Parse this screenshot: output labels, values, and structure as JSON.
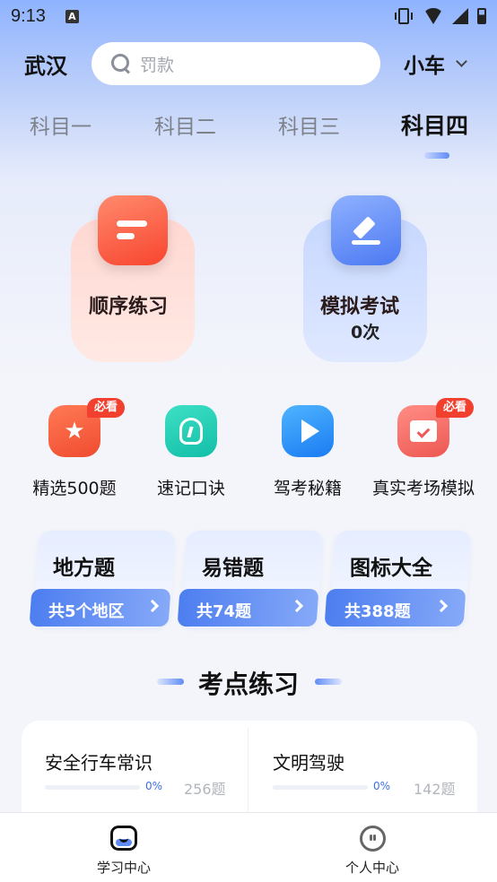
{
  "status_bar": {
    "time": "9:13",
    "notification_glyph": "A"
  },
  "header": {
    "city": "武汉",
    "search_placeholder": "罚款",
    "vehicle_type": "小车"
  },
  "subject_tabs": [
    {
      "label": "科目一",
      "active": false
    },
    {
      "label": "科目二",
      "active": false
    },
    {
      "label": "科目三",
      "active": false
    },
    {
      "label": "科目四",
      "active": true
    }
  ],
  "main_actions": {
    "sequential": {
      "label": "顺序练习",
      "icon": "list-icon"
    },
    "mock_exam": {
      "label": "模拟考试",
      "count": "0次",
      "icon": "pen-icon"
    }
  },
  "features": [
    {
      "label": "精选500题",
      "icon": "star-icon",
      "badge": "必看",
      "color": "#f4573c"
    },
    {
      "label": "速记口诀",
      "icon": "lightbulb-icon",
      "badge": "",
      "color": "#1cc9b3"
    },
    {
      "label": "驾考秘籍",
      "icon": "play-icon",
      "badge": "",
      "color": "#2d8bf7"
    },
    {
      "label": "真实考场模拟",
      "icon": "monitor-icon",
      "badge": "必看",
      "color": "#f05a56"
    }
  ],
  "mini_cards": [
    {
      "title": "地方题",
      "subtitle": "共5个地区"
    },
    {
      "title": "易错题",
      "subtitle": "共74题"
    },
    {
      "title": "图标大全",
      "subtitle": "共388题"
    }
  ],
  "section": {
    "title": "考点练习"
  },
  "practice_items": [
    {
      "title": "安全行车常识",
      "progress_text": "0%",
      "progress": 0,
      "count": "256题"
    },
    {
      "title": "文明驾驶",
      "progress_text": "0%",
      "progress": 0,
      "count": "142题"
    }
  ],
  "bottom_nav": [
    {
      "label": "学习中心",
      "icon": "study-icon",
      "active": true
    },
    {
      "label": "个人中心",
      "icon": "person-icon",
      "active": false
    }
  ],
  "colors": {
    "accent": "#4d7ef0",
    "badge": "#f2402f"
  }
}
